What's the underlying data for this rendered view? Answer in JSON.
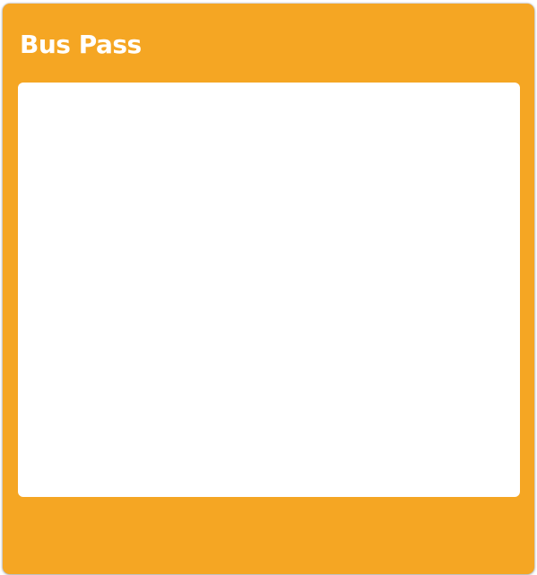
{
  "card": {
    "title": "Bus Pass",
    "accent_color": "#f5a623"
  }
}
